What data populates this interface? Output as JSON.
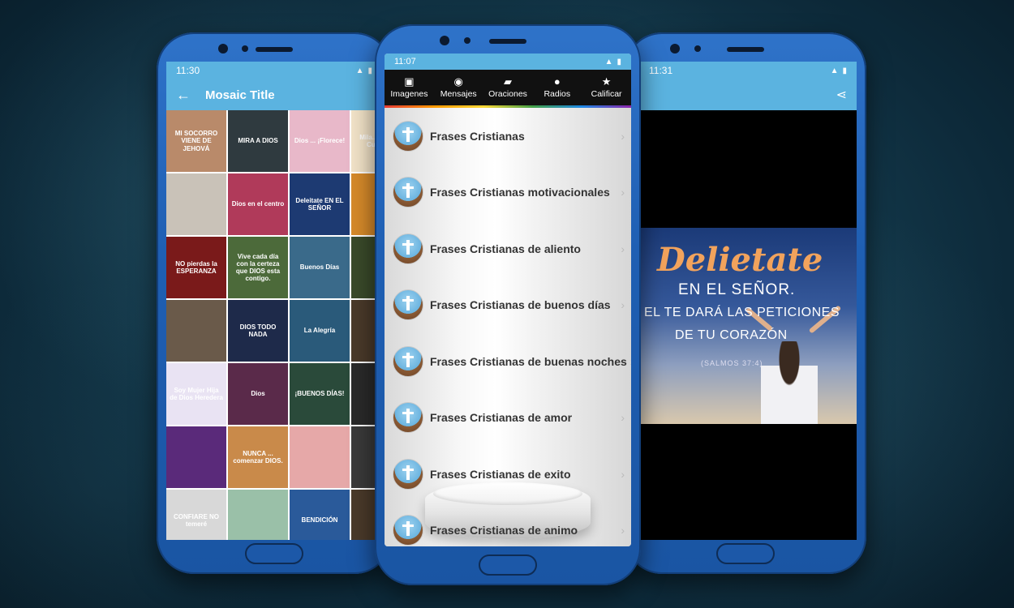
{
  "left_phone": {
    "status": {
      "time": "11:30"
    },
    "appbar": {
      "back_icon": "arrow-left-icon",
      "title": "Mosaic Title"
    },
    "tiles": [
      {
        "text": "MI SOCORRO VIENE DE JEHOVÁ",
        "color": "#b98a6a"
      },
      {
        "text": "MIRA A DIOS",
        "color": "#2f3a3f"
      },
      {
        "text": "Dios ... ¡Florece!",
        "color": "#e8b8c9"
      },
      {
        "text": "Mila... Abres... Cumple...",
        "color": "#f2e3c8"
      },
      {
        "text": "",
        "color": "#c9c2b8"
      },
      {
        "text": "Dios en el centro",
        "color": "#b03a5a"
      },
      {
        "text": "Deleitate EN EL SEÑOR",
        "color": "#1d3a72"
      },
      {
        "text": "",
        "color": "#d68a2a"
      },
      {
        "text": "NO pierdas la ESPERANZA",
        "color": "#7a1a1a"
      },
      {
        "text": "Vive cada día con la certeza que DIOS esta contigo.",
        "color": "#4c6a3a"
      },
      {
        "text": "Buenos Días",
        "color": "#3a6a8a"
      },
      {
        "text": "",
        "color": "#3a4a2a"
      },
      {
        "text": "",
        "color": "#6a5a4a"
      },
      {
        "text": "DIOS TODO NADA",
        "color": "#1e2a4a"
      },
      {
        "text": "La Alegría",
        "color": "#2a5a7a"
      },
      {
        "text": "",
        "color": "#4a3a2a"
      },
      {
        "text": "Soy Mujer Hija de Dios Heredera",
        "color": "#e9e3f3"
      },
      {
        "text": "Dios",
        "color": "#5a2a4a"
      },
      {
        "text": "¡BUENOS DÍAS!",
        "color": "#2a4a3a"
      },
      {
        "text": "",
        "color": "#2a2a2a"
      },
      {
        "text": "",
        "color": "#5a2a7a"
      },
      {
        "text": "NUNCA ... comenzar DIOS.",
        "color": "#c98a4a"
      },
      {
        "text": "",
        "color": "#e6a8a8"
      },
      {
        "text": "",
        "color": "#3a3a3a"
      },
      {
        "text": "CONFIARE NO temeré",
        "color": "#d8d8d8"
      },
      {
        "text": "",
        "color": "#9ac0a8"
      },
      {
        "text": "BENDICIÓN",
        "color": "#2a5a9a"
      },
      {
        "text": "",
        "color": "#4a3a2a"
      }
    ]
  },
  "mid_phone": {
    "status": {
      "time": "11:07"
    },
    "tabs": [
      {
        "label": "Imagenes",
        "icon": "image-icon"
      },
      {
        "label": "Mensajes",
        "icon": "chat-icon"
      },
      {
        "label": "Oraciones",
        "icon": "book-icon"
      },
      {
        "label": "Radios",
        "icon": "mic-icon"
      },
      {
        "label": "Calificar",
        "icon": "star-icon"
      }
    ],
    "items": [
      "Frases Cristianas",
      "Frases Cristianas motivacionales",
      "Frases Cristianas de aliento",
      "Frases Cristianas de buenos días",
      "Frases Cristianas de buenas noches",
      "Frases Cristianas de amor",
      "Frases Cristianas de exito",
      "Frases Cristianas de animo"
    ]
  },
  "right_phone": {
    "status": {
      "time": "11:31"
    },
    "share_icon": "share-icon",
    "image": {
      "title": "Delietate",
      "line1": "EN EL SEÑOR.",
      "line2": "EL TE DARÁ LAS PETICIONES",
      "line3": "DE TU CORAZÓN",
      "cite": "(SALMOS 37:4)"
    }
  },
  "colors": {
    "appbar": "#5bb3e0",
    "phone_frame": "#1f5fb3",
    "tabbar": "#111111"
  }
}
